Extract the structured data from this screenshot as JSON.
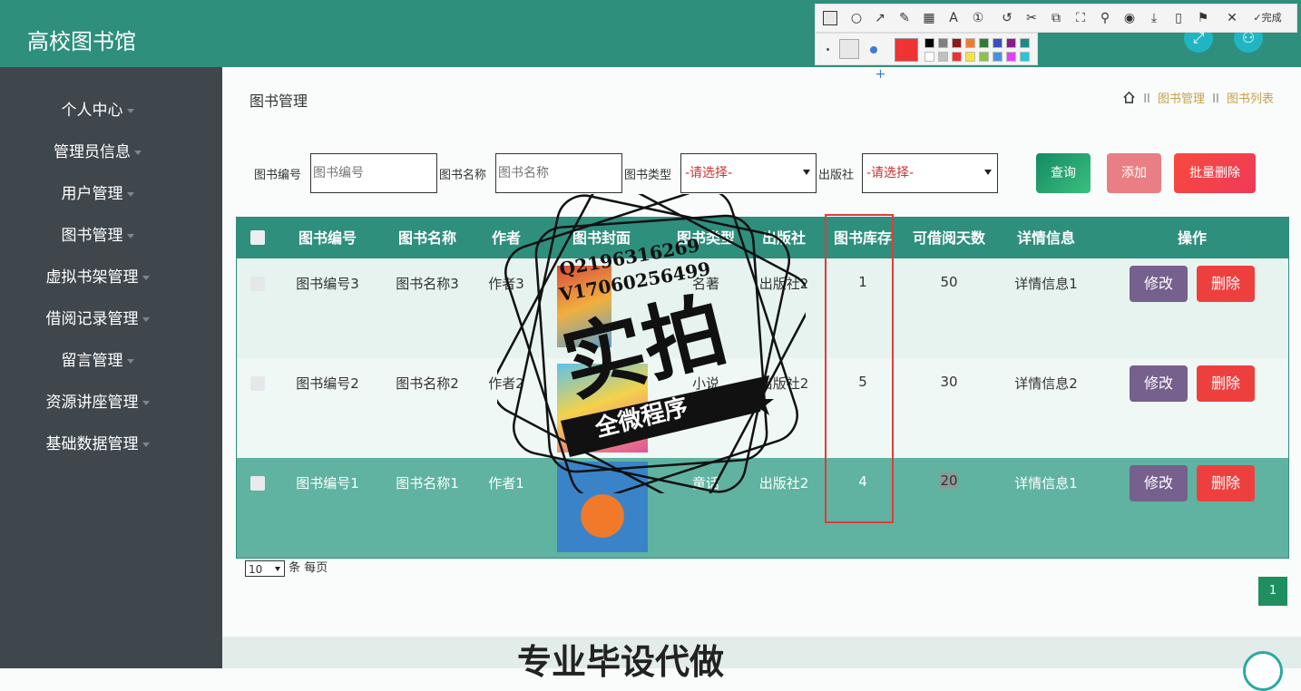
{
  "app": {
    "title": "高校图书馆"
  },
  "sidebar": {
    "items": [
      {
        "label": "个人中心"
      },
      {
        "label": "管理员信息"
      },
      {
        "label": "用户管理"
      },
      {
        "label": "图书管理"
      },
      {
        "label": "虚拟书架管理"
      },
      {
        "label": "借阅记录管理"
      },
      {
        "label": "留言管理"
      },
      {
        "label": "资源讲座管理"
      },
      {
        "label": "基础数据管理"
      }
    ]
  },
  "page": {
    "title": "图书管理",
    "breadcrumb": [
      "图书管理",
      "图书列表"
    ]
  },
  "search": {
    "book_no_label": "图书编号",
    "book_no_placeholder": "图书编号",
    "book_name_label": "图书名称",
    "book_name_placeholder": "图书名称",
    "book_type_label": "图书类型",
    "book_type_value": "-请选择-",
    "publisher_label": "出版社",
    "publisher_value": "-请选择-",
    "query_btn": "查询",
    "add_btn": "添加",
    "batch_delete_btn": "批量删除"
  },
  "table": {
    "headers": [
      "图书编号",
      "图书名称",
      "作者",
      "图书封面",
      "图书类型",
      "出版社",
      "图书库存",
      "可借阅天数",
      "详情信息",
      "操作"
    ],
    "rows": [
      {
        "no": "图书编号3",
        "name": "图书名称3",
        "author": "作者3",
        "type": "名著",
        "publisher": "出版社2",
        "stock": "1",
        "days": "50",
        "detail": "详情信息1",
        "edit": "修改",
        "delete": "删除"
      },
      {
        "no": "图书编号2",
        "name": "图书名称2",
        "author": "作者2",
        "type": "小说",
        "publisher": "出版社2",
        "stock": "5",
        "days": "30",
        "detail": "详情信息2",
        "edit": "修改",
        "delete": "删除"
      },
      {
        "no": "图书编号1",
        "name": "图书名称1",
        "author": "作者1",
        "type": "童话",
        "publisher": "出版社2",
        "stock": "4",
        "days": "20",
        "detail": "详情信息1",
        "edit": "修改",
        "delete": "删除"
      }
    ]
  },
  "pagination": {
    "page_size": "10",
    "per_page_text": "条 每页",
    "current_page": "1"
  },
  "footer": {
    "text": "专业毕设代做"
  },
  "watermark": {
    "line1": "Q2196316269",
    "line2": "V17060256499",
    "big": "实拍",
    "ribbon": "全微程序"
  },
  "annotation_toolbar": {
    "done_label": "完成"
  },
  "colors": {
    "header_green": "#2e8f7d",
    "sidebar": "#3f474d",
    "edit": "#75608e",
    "delete": "#ee3f3f",
    "highlight": "#e03c3c"
  }
}
